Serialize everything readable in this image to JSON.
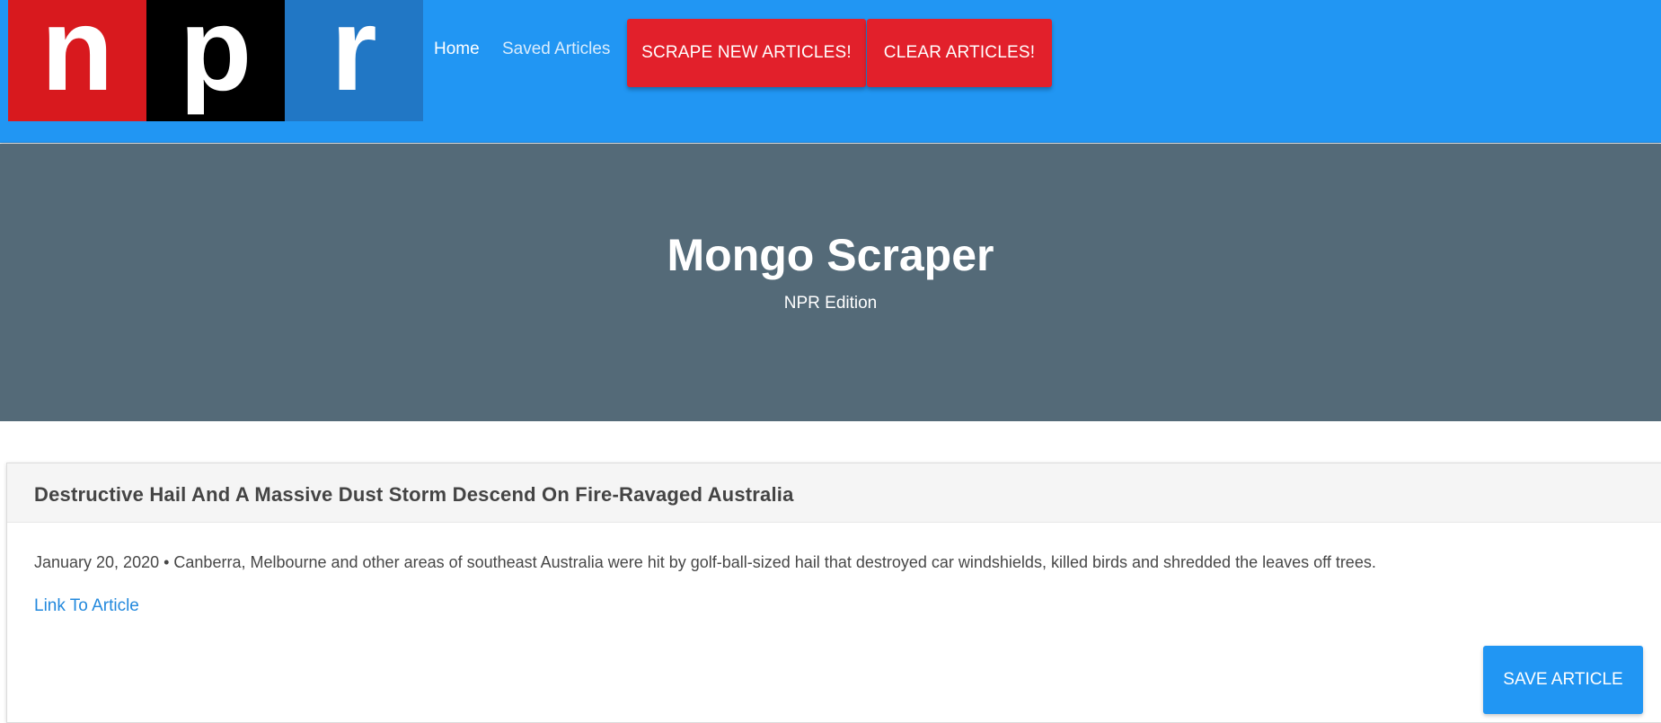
{
  "logo": {
    "letters": [
      "n",
      "p",
      "r"
    ],
    "colors": [
      "#d8191e",
      "#000000",
      "#2177c5"
    ]
  },
  "nav": {
    "home_label": "Home",
    "saved_label": "Saved Articles"
  },
  "buttons": {
    "scrape_label": "SCRAPE NEW ARTICLES!",
    "clear_label": "CLEAR ARTICLES!"
  },
  "hero": {
    "title": "Mongo Scraper",
    "subtitle": "NPR Edition"
  },
  "articles": [
    {
      "title": "Destructive Hail And A Massive Dust Storm Descend On Fire-Ravaged Australia",
      "summary": "January 20, 2020 • Canberra, Melbourne and other areas of southeast Australia were hit by golf-ball-sized hail that destroyed car windshields, killed birds and shredded the leaves off trees.",
      "link_label": "Link To Article",
      "save_label": "SAVE ARTICLE"
    }
  ],
  "colors": {
    "navbar": "#2196f3",
    "hero": "#546a78",
    "danger": "#e2202b",
    "link": "#2389dd"
  }
}
